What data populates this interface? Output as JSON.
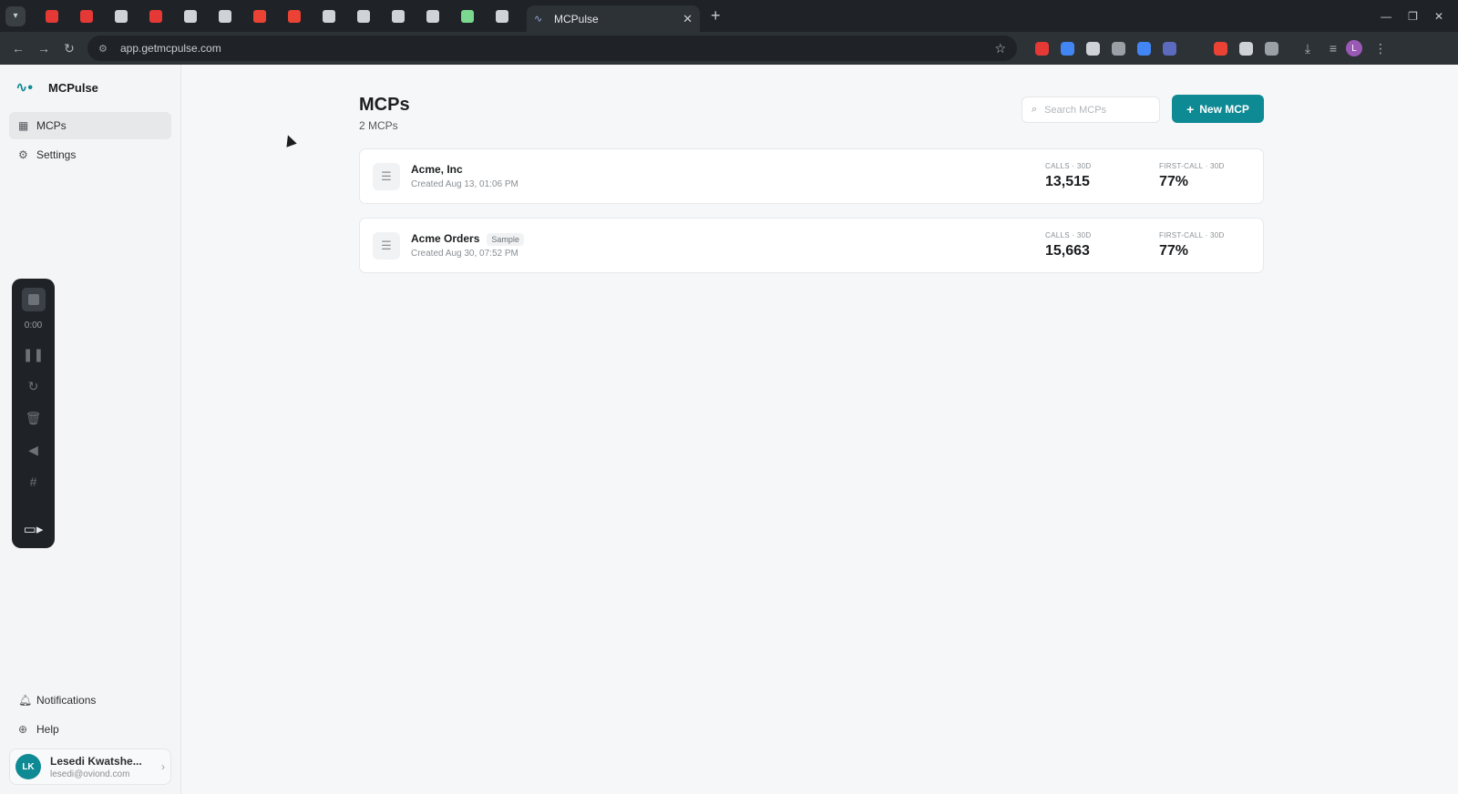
{
  "browser": {
    "active_tab_title": "MCPulse",
    "url": "app.getmcpulse.com",
    "profile_initial": "L",
    "pinned_favicon_colors": [
      "#e53935",
      "#e53935",
      "#cfd3d7",
      "#e53935",
      "#cfd3d7",
      "#cfd3d7",
      "#ea4335",
      "#ea4335",
      "#cfd3d7",
      "#cfd3d7",
      "#cfd3d7",
      "#cfd3d7",
      "#7bd88f",
      "#cfd3d7"
    ],
    "extension_colors": [
      "#e53935",
      "#4285f4",
      "#cfd3d7",
      "#9aa0a6",
      "#4285f4",
      "#5c6bc0",
      "#2d3237",
      "#ea4335",
      "#cfd3d7",
      "#9aa0a6"
    ]
  },
  "sidebar": {
    "brand": "MCPulse",
    "nav": [
      {
        "label": "MCPs",
        "icon": "grid-icon",
        "active": true
      },
      {
        "label": "Settings",
        "icon": "gear-icon",
        "active": false
      }
    ],
    "bottom_nav": [
      {
        "label": "Notifications",
        "icon": "bell-icon"
      },
      {
        "label": "Help",
        "icon": "globe-icon"
      }
    ],
    "user": {
      "initials": "LK",
      "name": "Lesedi Kwatshe...",
      "email": "lesedi@oviond.com"
    }
  },
  "recorder": {
    "time": "0:00"
  },
  "main": {
    "title": "MCPs",
    "count": "2 MCPs",
    "search_placeholder": "Search MCPs",
    "new_button": "New MCP",
    "mcps": [
      {
        "name": "Acme, Inc",
        "badge": "",
        "created": "Created Aug 13, 01:06 PM",
        "calls_label": "CALLS · 30D",
        "calls": "13,515",
        "first_label": "FIRST-CALL · 30D",
        "first": "77%"
      },
      {
        "name": "Acme Orders",
        "badge": "Sample",
        "created": "Created Aug 30, 07:52 PM",
        "calls_label": "CALLS · 30D",
        "calls": "15,663",
        "first_label": "FIRST-CALL · 30D",
        "first": "77%"
      }
    ]
  },
  "colors": {
    "accent": "#0e8a94",
    "sidebar_bg": "#f4f5f6",
    "page_bg": "#f6f7f8"
  }
}
